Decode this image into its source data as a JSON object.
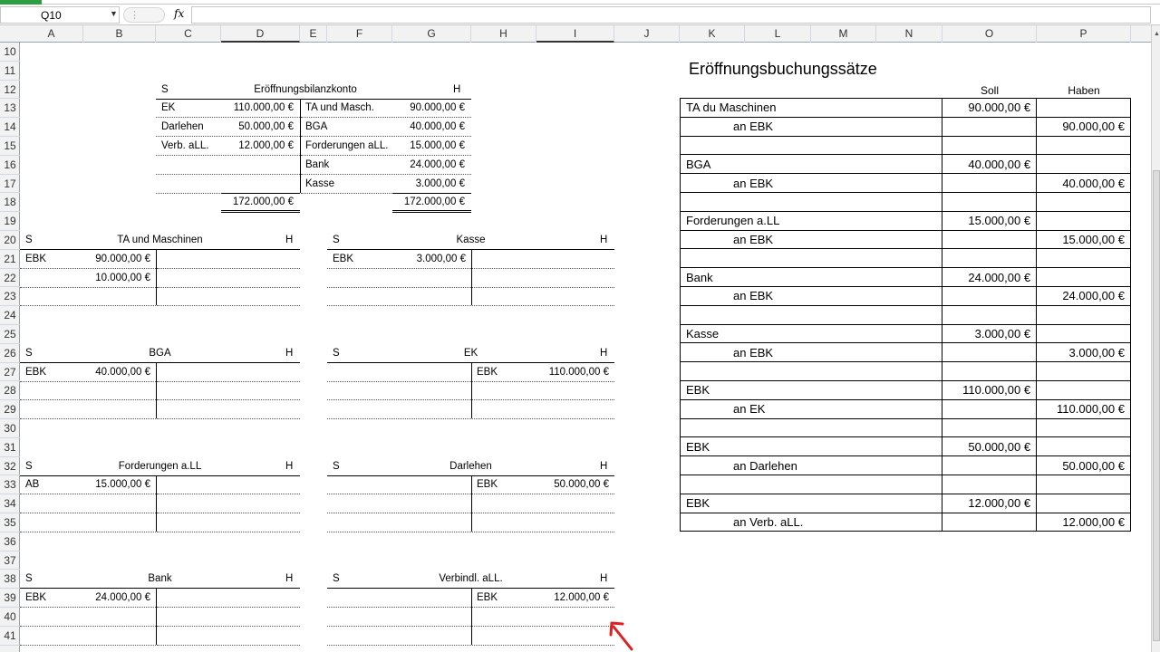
{
  "formula_bar": {
    "name_box": "Q10",
    "fx_label": "fx",
    "formula": ""
  },
  "columns": [
    "A",
    "B",
    "C",
    "D",
    "E",
    "F",
    "G",
    "H",
    "I",
    "J",
    "K",
    "L",
    "M",
    "N",
    "O",
    "P"
  ],
  "rows": [
    "10",
    "11",
    "12",
    "13",
    "14",
    "15",
    "16",
    "17",
    "18",
    "19",
    "20",
    "21",
    "22",
    "23",
    "24",
    "25",
    "26",
    "27",
    "28",
    "29",
    "30",
    "31",
    "32",
    "33",
    "34",
    "35",
    "36",
    "37",
    "38",
    "39",
    "40",
    "41"
  ],
  "ebk": {
    "s": "S",
    "title": "Eröffnungsbilanzkonto",
    "h": "H",
    "left": [
      {
        "label": "EK",
        "value": "110.000,00 €"
      },
      {
        "label": "Darlehen",
        "value": "50.000,00 €"
      },
      {
        "label": "Verb. aLL.",
        "value": "12.000,00 €"
      }
    ],
    "right": [
      {
        "label": "TA und Masch.",
        "value": "90.000,00 €"
      },
      {
        "label": "BGA",
        "value": "40.000,00 €"
      },
      {
        "label": "Forderungen aLL.",
        "value": "15.000,00 €"
      },
      {
        "label": "Bank",
        "value": "24.000,00 €"
      },
      {
        "label": "Kasse",
        "value": "3.000,00 €"
      }
    ],
    "total_left": "172.000,00 €",
    "total_right": "172.000,00 €"
  },
  "t_accounts": [
    {
      "s": "S",
      "title": "TA und Maschinen",
      "h": "H",
      "left": [
        {
          "label": "EBK",
          "value": "90.000,00 €"
        },
        {
          "label": "",
          "value": "10.000,00 €"
        }
      ],
      "right": []
    },
    {
      "s": "S",
      "title": "Kasse",
      "h": "H",
      "left": [
        {
          "label": "EBK",
          "value": "3.000,00 €"
        }
      ],
      "right": []
    },
    {
      "s": "S",
      "title": "BGA",
      "h": "H",
      "left": [
        {
          "label": "EBK",
          "value": "40.000,00 €"
        }
      ],
      "right": []
    },
    {
      "s": "S",
      "title": "EK",
      "h": "H",
      "left": [],
      "right": [
        {
          "label": "EBK",
          "value": "110.000,00 €"
        }
      ]
    },
    {
      "s": "S",
      "title": "Forderungen a.LL",
      "h": "H",
      "left": [
        {
          "label": "AB",
          "value": "15.000,00 €"
        }
      ],
      "right": []
    },
    {
      "s": "S",
      "title": "Darlehen",
      "h": "H",
      "left": [],
      "right": [
        {
          "label": "EBK",
          "value": "50.000,00 €"
        }
      ]
    },
    {
      "s": "S",
      "title": "Bank",
      "h": "H",
      "left": [
        {
          "label": "EBK",
          "value": "24.000,00 €"
        }
      ],
      "right": []
    },
    {
      "s": "S",
      "title": "Verbindl. aLL.",
      "h": "H",
      "left": [],
      "right": [
        {
          "label": "EBK",
          "value": "12.000,00 €"
        }
      ]
    }
  ],
  "buchungssaetze": {
    "title": "Eröffnungsbuchungssätze",
    "soll_header": "Soll",
    "haben_header": "Haben",
    "entries": [
      {
        "debit": "TA du Maschinen",
        "soll": "90.000,00 €",
        "credit": "an   EBK",
        "haben": "90.000,00 €"
      },
      {
        "debit": "BGA",
        "soll": "40.000,00 €",
        "credit": "an  EBK",
        "haben": "40.000,00 €"
      },
      {
        "debit": "Forderungen a.LL",
        "soll": "15.000,00 €",
        "credit": "an  EBK",
        "haben": "15.000,00 €"
      },
      {
        "debit": "Bank",
        "soll": "24.000,00 €",
        "credit": "an  EBK",
        "haben": "24.000,00 €"
      },
      {
        "debit": "Kasse",
        "soll": "3.000,00 €",
        "credit": "an  EBK",
        "haben": "3.000,00 €"
      },
      {
        "debit": "EBK",
        "soll": "110.000,00 €",
        "credit": "an  EK",
        "haben": "110.000,00 €"
      },
      {
        "debit": "EBK",
        "soll": "50.000,00 €",
        "credit": "an  Darlehen",
        "haben": "50.000,00 €"
      },
      {
        "debit": "EBK",
        "soll": "12.000,00 €",
        "credit": "an  Verb. aLL.",
        "haben": "12.000,00 €"
      }
    ]
  },
  "colors": {
    "accent_green": "#2e9e43",
    "annotation_arrow": "#e02020",
    "header_bg": "#f2f2f2"
  },
  "icons": {
    "annotation": "red-arrow-icon"
  }
}
